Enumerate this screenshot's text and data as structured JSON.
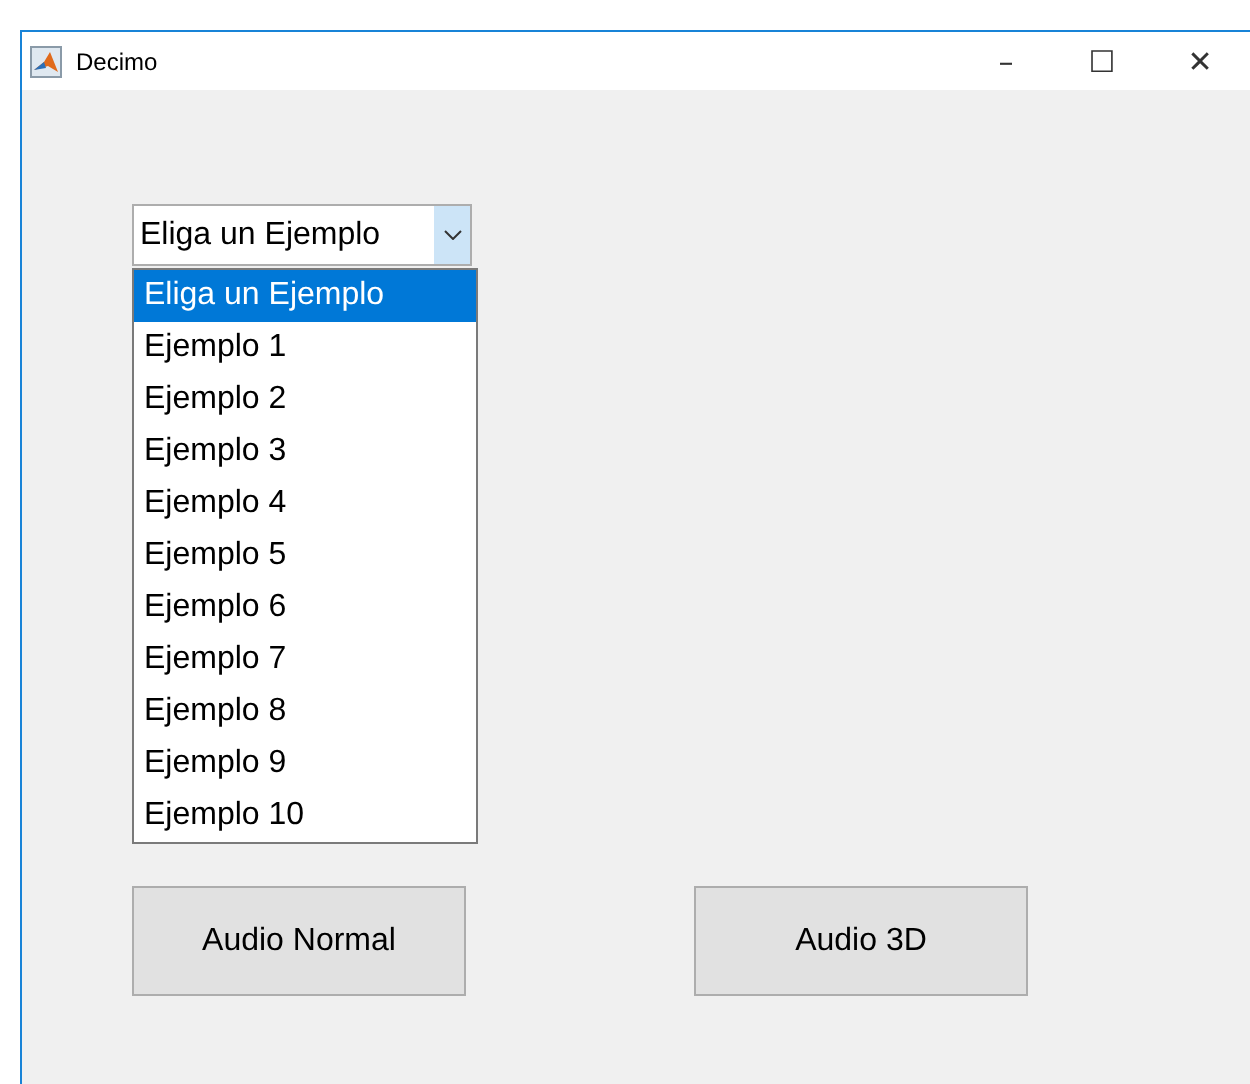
{
  "window": {
    "title": "Decimo",
    "controls": [
      "–",
      "☐",
      "✕"
    ]
  },
  "dropdown": {
    "value": "Eliga un Ejemplo",
    "expanded": true,
    "options": [
      {
        "label": "Eliga un Ejemplo",
        "selected": true
      },
      {
        "label": "Ejemplo 1",
        "selected": false
      },
      {
        "label": "Ejemplo 2",
        "selected": false
      },
      {
        "label": "Ejemplo 3",
        "selected": false
      },
      {
        "label": "Ejemplo 4",
        "selected": false
      },
      {
        "label": "Ejemplo 5",
        "selected": false
      },
      {
        "label": "Ejemplo 6",
        "selected": false
      },
      {
        "label": "Ejemplo 7",
        "selected": false
      },
      {
        "label": "Ejemplo 8",
        "selected": false
      },
      {
        "label": "Ejemplo 9",
        "selected": false
      },
      {
        "label": "Ejemplo 10",
        "selected": false
      }
    ]
  },
  "buttons": [
    "Audio Normal",
    "Audio 3D"
  ]
}
